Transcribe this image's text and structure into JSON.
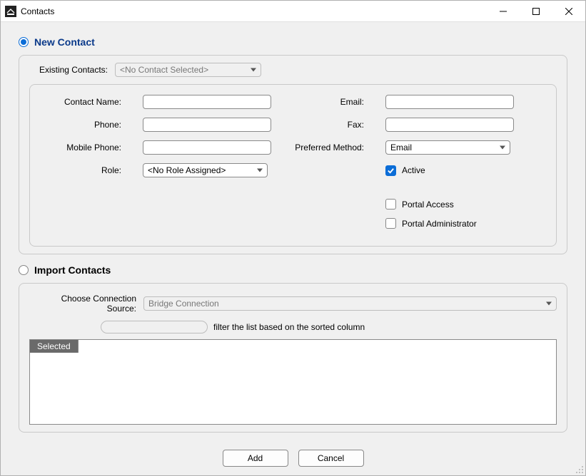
{
  "window": {
    "title": "Contacts"
  },
  "sections": {
    "new_contact_label": "New Contact",
    "import_contacts_label": "Import Contacts"
  },
  "existing": {
    "label": "Existing Contacts:",
    "value": "<No Contact Selected>"
  },
  "form": {
    "contact_name_label": "Contact Name:",
    "contact_name_value": "",
    "email_label": "Email:",
    "email_value": "",
    "phone_label": "Phone:",
    "phone_value": "",
    "fax_label": "Fax:",
    "fax_value": "",
    "mobile_label": "Mobile Phone:",
    "mobile_value": "",
    "preferred_label": "Preferred Method:",
    "preferred_value": "Email",
    "role_label": "Role:",
    "role_value": "<No Role Assigned>",
    "active_label": "Active",
    "portal_access_label": "Portal Access",
    "portal_admin_label": "Portal Administrator"
  },
  "import": {
    "source_label": "Choose Connection Source:",
    "source_value": "Bridge Connection",
    "filter_hint": "filter the list based on the sorted column",
    "grid_header": "Selected"
  },
  "buttons": {
    "add": "Add",
    "cancel": "Cancel"
  }
}
